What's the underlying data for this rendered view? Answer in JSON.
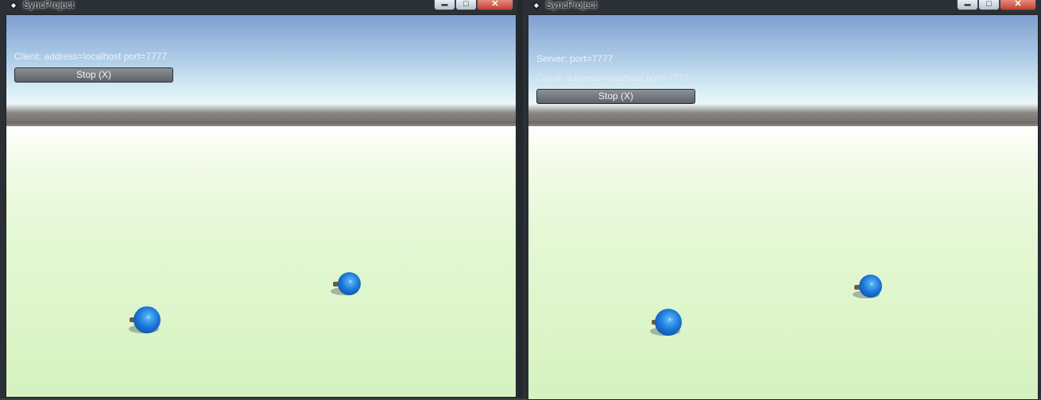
{
  "windows": [
    {
      "title": "SyncProject",
      "status_lines": [
        "Client: address=localhost port=7777"
      ],
      "stop_label": "Stop (X)",
      "controls": {
        "minimize": "▬",
        "maximize": "□",
        "close": "✕"
      }
    },
    {
      "title": "SyncProject",
      "status_lines": [
        "Server: port=7777",
        "Client: address=localhost port=7777"
      ],
      "stop_label": "Stop (X)",
      "controls": {
        "minimize": "▬",
        "maximize": "□",
        "close": "✕"
      }
    }
  ],
  "colors": {
    "sky_top": "#7e9fcf",
    "ground": "#d6f2c0",
    "ball": "#1d78d8"
  }
}
